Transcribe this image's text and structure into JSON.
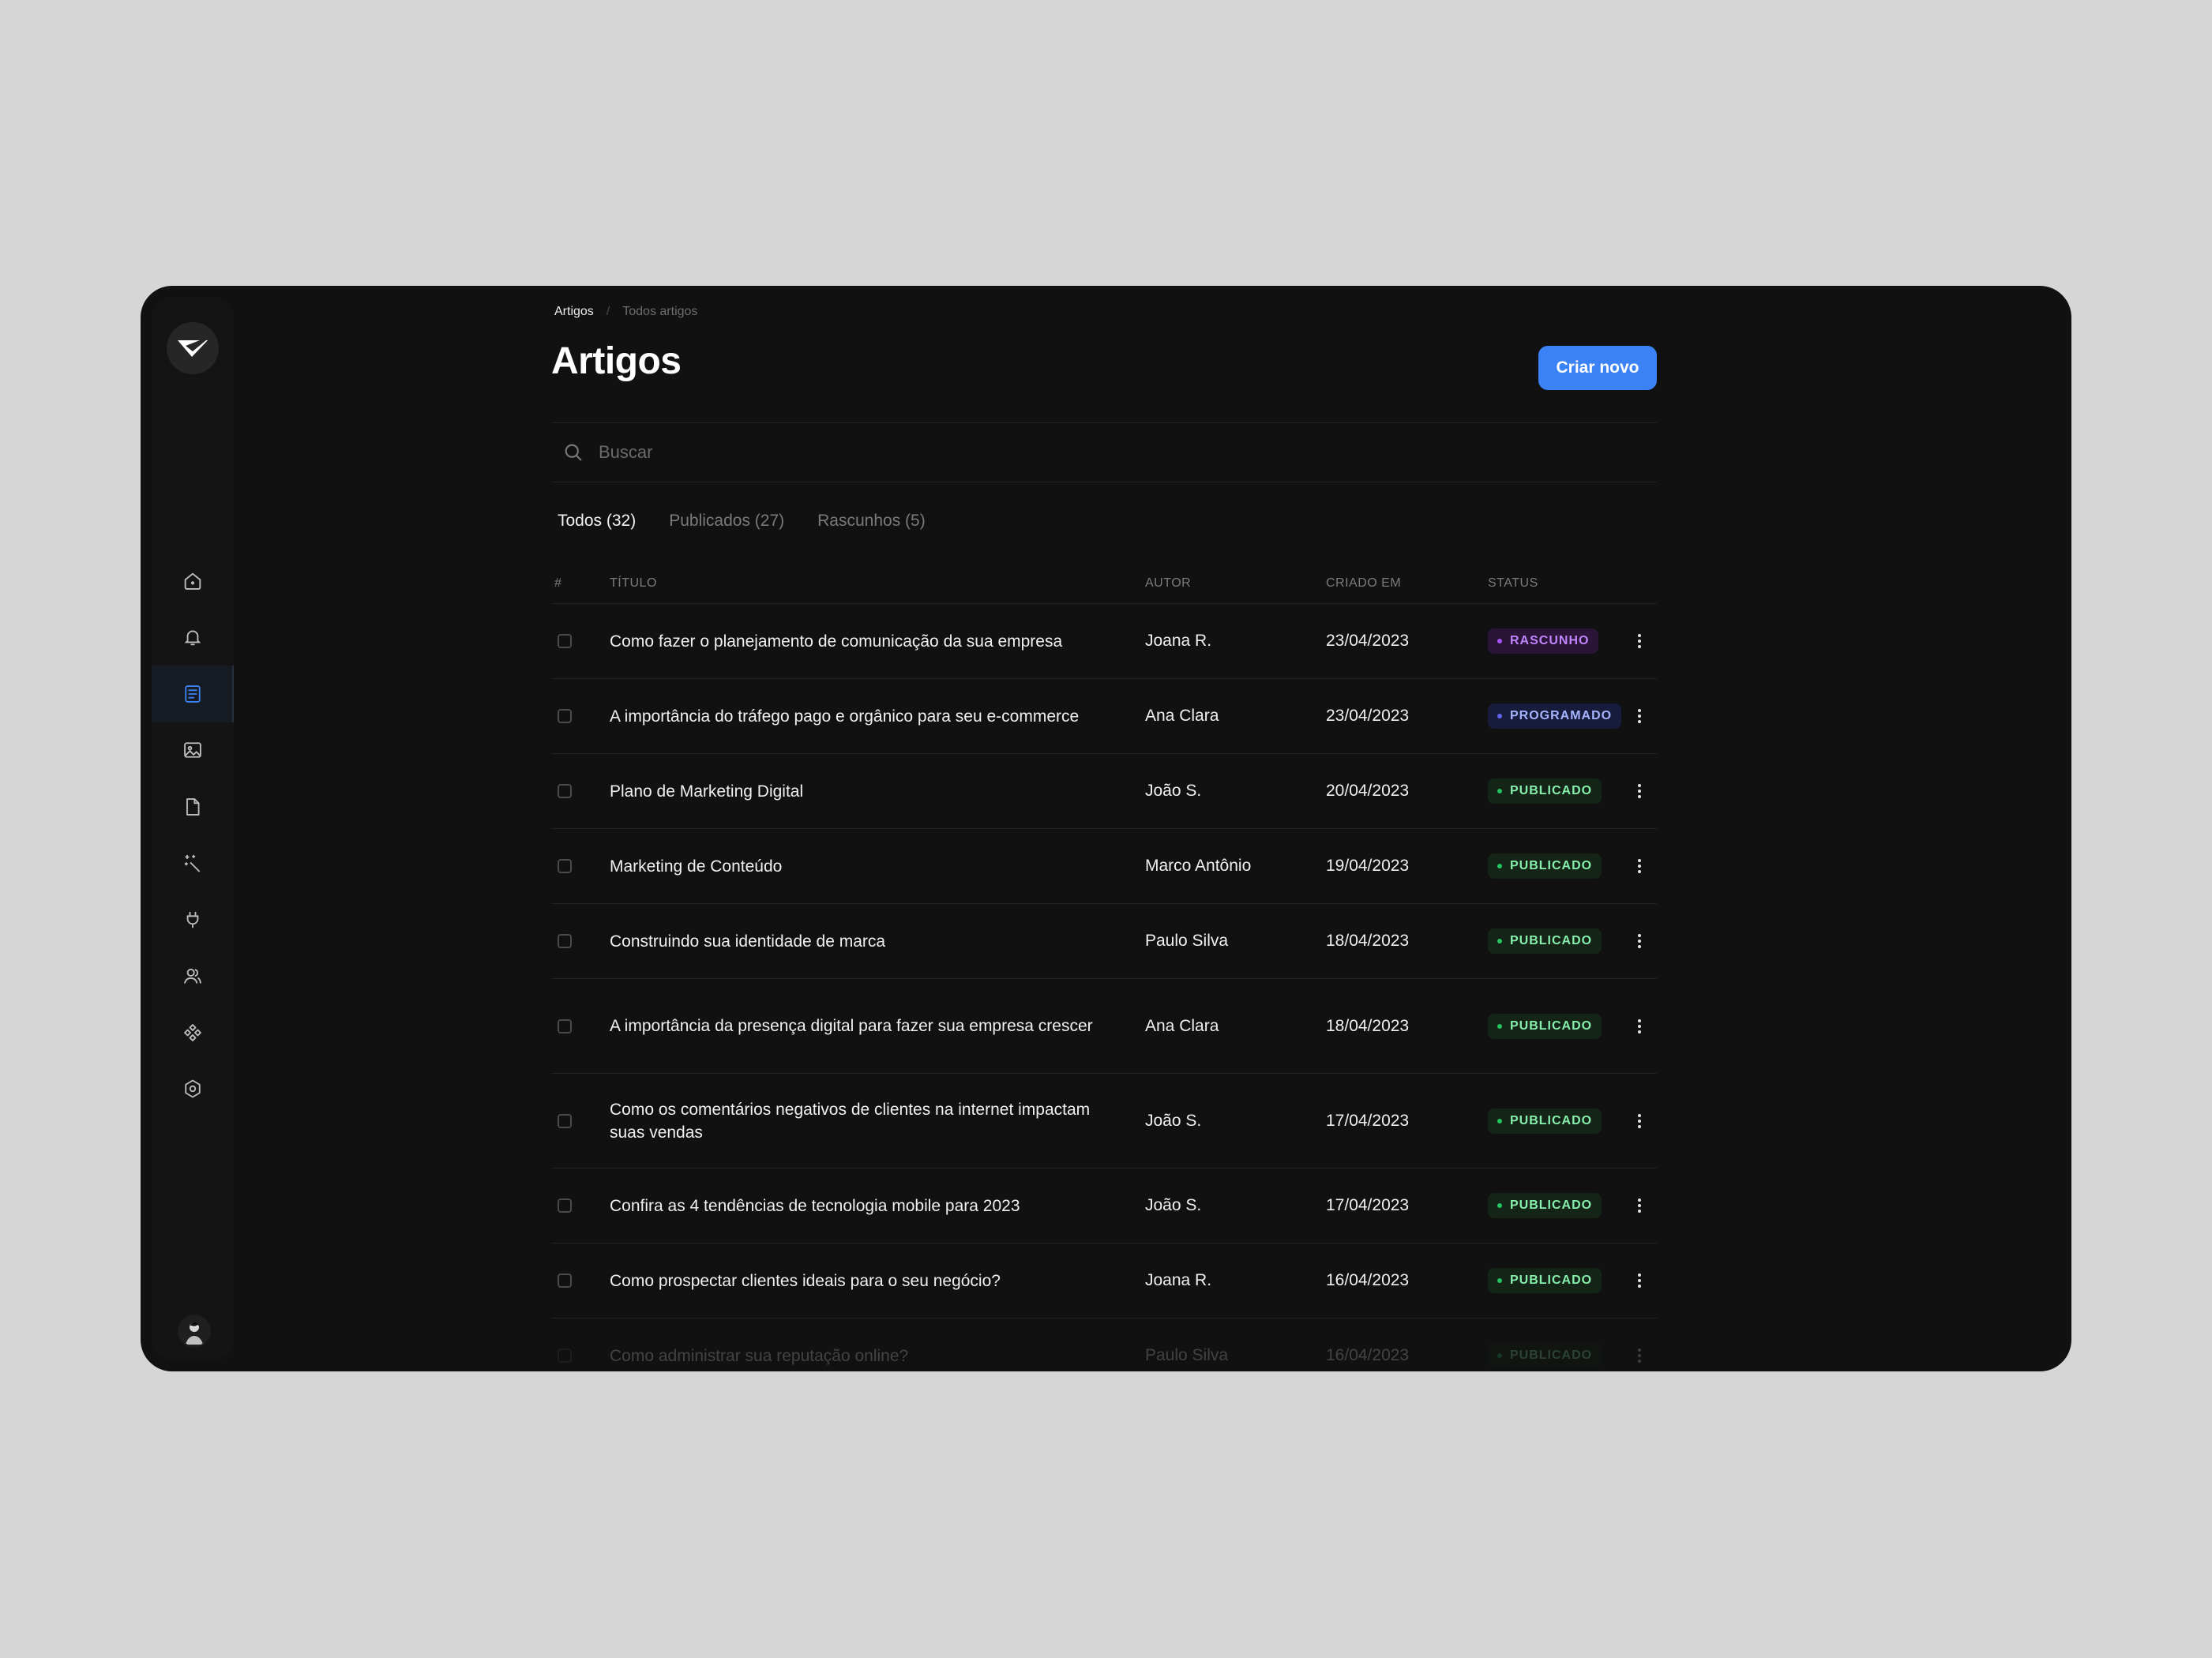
{
  "colors": {
    "accent": "#3b82f6",
    "status": {
      "RASCUNHO": {
        "bg": "#2a1538",
        "fg": "#c084fc",
        "dot": "#a855f7"
      },
      "PROGRAMADO": {
        "bg": "#171c3d",
        "fg": "#a5b4fc",
        "dot": "#6366f1"
      },
      "PUBLICADO": {
        "bg": "#142417",
        "fg": "#86efac",
        "dot": "#22c55e"
      }
    }
  },
  "sidebar": {
    "logo": "logo-check-icon",
    "items": [
      {
        "name": "home",
        "icon": "home-icon",
        "active": false
      },
      {
        "name": "notifications",
        "icon": "bell-icon",
        "active": false
      },
      {
        "name": "articles",
        "icon": "document-list-icon",
        "active": true
      },
      {
        "name": "media",
        "icon": "image-icon",
        "active": false
      },
      {
        "name": "pages",
        "icon": "file-icon",
        "active": false
      },
      {
        "name": "magic",
        "icon": "magic-wand-icon",
        "active": false
      },
      {
        "name": "integrations",
        "icon": "plug-icon",
        "active": false
      },
      {
        "name": "users",
        "icon": "users-icon",
        "active": false
      },
      {
        "name": "plugins",
        "icon": "puzzle-icon",
        "active": false
      },
      {
        "name": "settings",
        "icon": "gear-icon",
        "active": false
      }
    ],
    "avatar": "user-avatar"
  },
  "header": {
    "breadcrumb": [
      "Artigos",
      "/",
      "Todos artigos"
    ],
    "title": "Artigos",
    "create_label": "Criar novo"
  },
  "search": {
    "placeholder": "Buscar"
  },
  "tabs": [
    {
      "label": "Todos (32)",
      "active": true
    },
    {
      "label": "Publicados (27)",
      "active": false
    },
    {
      "label": "Rascunhos (5)",
      "active": false
    }
  ],
  "table": {
    "headers": [
      "#",
      "TÍTULO",
      "AUTOR",
      "CRIADO EM",
      "STATUS"
    ],
    "rows": [
      {
        "title": "Como fazer o planejamento de comunicação da sua empresa",
        "author": "Joana R.",
        "date": "23/04/2023",
        "status": "RASCUNHO"
      },
      {
        "title": "A importância do tráfego pago e orgânico para seu e-commerce",
        "author": "Ana Clara",
        "date": "23/04/2023",
        "status": "PROGRAMADO"
      },
      {
        "title": "Plano de Marketing Digital",
        "author": "João S.",
        "date": "20/04/2023",
        "status": "PUBLICADO"
      },
      {
        "title": "Marketing de Conteúdo",
        "author": "Marco Antônio",
        "date": "19/04/2023",
        "status": "PUBLICADO"
      },
      {
        "title": "Construindo sua identidade de marca",
        "author": "Paulo Silva",
        "date": "18/04/2023",
        "status": "PUBLICADO"
      },
      {
        "title": "A importância da presença digital para fazer sua empresa crescer",
        "author": "Ana Clara",
        "date": "18/04/2023",
        "status": "PUBLICADO"
      },
      {
        "title": "Como os comentários negativos de clientes na internet impactam suas vendas",
        "author": "João S.",
        "date": "17/04/2023",
        "status": "PUBLICADO"
      },
      {
        "title": "Confira as 4 tendências de tecnologia mobile para 2023",
        "author": "João S.",
        "date": "17/04/2023",
        "status": "PUBLICADO"
      },
      {
        "title": "Como prospectar clientes ideais para o seu negócio?",
        "author": "Joana R.",
        "date": "16/04/2023",
        "status": "PUBLICADO"
      },
      {
        "title": "Como administrar sua reputação online?",
        "author": "Paulo Silva",
        "date": "16/04/2023",
        "status": "PUBLICADO"
      }
    ]
  }
}
